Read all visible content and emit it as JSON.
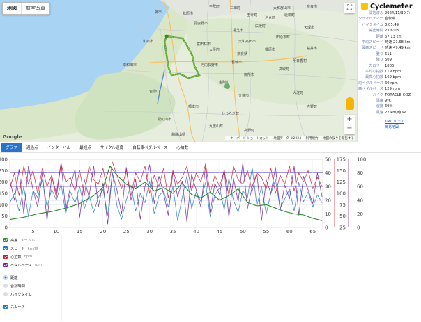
{
  "map": {
    "tabs": [
      {
        "label": "地図",
        "active": true
      },
      {
        "label": "航空写真",
        "active": false
      }
    ],
    "google": "Google",
    "attribution": {
      "shortcuts": "キーボード ショートカット",
      "mapdata": "地図データ ©2024",
      "terms": "利用規約",
      "report": "地図の誤りを報告する"
    },
    "places": [
      "堺市",
      "松原市",
      "羽曳野市",
      "富田林市",
      "河内長野市",
      "和泉市",
      "岸和田市",
      "大阪府",
      "奈良県",
      "金剛山",
      "五條市",
      "御所市",
      "橿原市",
      "大和高田市",
      "香芝市",
      "葛城市",
      "広陵町",
      "王寺町",
      "田原本町",
      "天理市",
      "桜井市",
      "大淀町",
      "吉野町",
      "高取町",
      "明日香村",
      "岩湧山",
      "和歌山県",
      "紀の川市",
      "橋本市",
      "かつらぎ町",
      "九度山町",
      "高野町",
      "大和郡山市",
      "奈良市",
      "河合町",
      "三郷町",
      "平群町",
      "斑鳩町"
    ]
  },
  "info": {
    "app_name": "Cyclemeter",
    "stats": [
      {
        "label": "開始済み",
        "value": "2024/11/30 7:"
      },
      {
        "label": "アクティビティー",
        "value": "自転車"
      },
      {
        "label": "バイクタイム",
        "value": "3:05:49"
      },
      {
        "label": "停止時間",
        "value": "2:06:03"
      },
      {
        "label": "距離",
        "value": "67.13 km"
      },
      {
        "label": "平均スピード",
        "value": "時速 21.68 km"
      },
      {
        "label": "最高スピード",
        "value": "時速 49.49 km"
      },
      {
        "label": "登り",
        "value": "611"
      },
      {
        "label": "降り",
        "value": "609"
      },
      {
        "label": "カロリー",
        "value": "1886"
      },
      {
        "label": "平均心拍数",
        "value": "119 bpm"
      },
      {
        "label": "最高心拍数",
        "value": "169 bpm"
      },
      {
        "label": "平均ペダルペース",
        "value": "60 rpm"
      },
      {
        "label": "最高ペダルペース",
        "value": "129 rpm"
      },
      {
        "label": "バイク",
        "value": "TORACLE-COZ"
      },
      {
        "label": "温度",
        "value": "9ºC"
      },
      {
        "label": "湿度",
        "value": "69%"
      },
      {
        "label": "風速",
        "value": "22 km/時 W"
      }
    ],
    "kml_link": "KML リンク",
    "more_link": "簡易地図"
  },
  "tabs": [
    {
      "label": "グラフ",
      "active": true
    },
    {
      "label": "通過点",
      "active": false
    },
    {
      "label": "インターバル",
      "active": false
    },
    {
      "label": "最短点",
      "active": false
    },
    {
      "label": "サイクル速度",
      "active": false
    },
    {
      "label": "自転車ペダルペース",
      "active": false
    },
    {
      "label": "心拍数",
      "active": false
    }
  ],
  "options": {
    "series": [
      {
        "label": "高度",
        "unit": "メートル",
        "color": "#2b8a2b",
        "checked": true
      },
      {
        "label": "スピード",
        "unit": "km/時",
        "color": "#1f78c8",
        "checked": true
      },
      {
        "label": "心拍数",
        "unit": "bpm",
        "color": "#d0192b",
        "checked": true
      },
      {
        "label": "ペダルペース",
        "unit": "rpm",
        "color": "#6a1b9a",
        "checked": true
      }
    ],
    "xaxis": [
      {
        "label": "距離",
        "selected": true
      },
      {
        "label": "合計時間",
        "selected": false
      },
      {
        "label": "バイクタイム",
        "selected": false
      }
    ],
    "smooth": {
      "label": "スムーズ",
      "checked": true
    }
  },
  "chart_data": {
    "type": "line",
    "x": {
      "label": "距離 (km)",
      "ticks": [
        5,
        10,
        15,
        20,
        25,
        30,
        35,
        40,
        45,
        50,
        55,
        60,
        65
      ],
      "range": [
        0,
        67.13
      ]
    },
    "axes": {
      "altitude": {
        "ticks": [
          0,
          50,
          100,
          150,
          200,
          250,
          300
        ],
        "range": [
          0,
          300
        ]
      },
      "speed": {
        "ticks": [
          0,
          10,
          20,
          30,
          40,
          50
        ],
        "range": [
          0,
          50
        ]
      },
      "heart_rate": {
        "ticks": [
          25,
          50,
          75,
          100,
          125,
          150,
          175
        ],
        "range": [
          25,
          175
        ]
      },
      "cadence": {
        "ticks": [
          0,
          20,
          40,
          60,
          80,
          100
        ],
        "range": [
          0,
          100
        ]
      }
    },
    "series": [
      {
        "name": "高度",
        "axis": "altitude",
        "color": "#2b8a2b",
        "x": [
          0,
          3,
          6,
          9,
          12,
          15,
          18,
          20,
          21.5,
          23,
          25,
          27,
          29,
          31,
          33,
          35,
          37,
          39,
          41,
          43,
          45,
          47,
          49,
          51,
          53,
          55,
          57,
          59,
          61,
          63,
          65,
          67
        ],
        "y": [
          35,
          45,
          60,
          70,
          85,
          105,
          140,
          175,
          270,
          230,
          190,
          170,
          200,
          160,
          175,
          150,
          195,
          145,
          130,
          155,
          120,
          140,
          170,
          110,
          95,
          100,
          85,
          70,
          60,
          55,
          40,
          30
        ]
      },
      {
        "name": "スピード",
        "axis": "speed",
        "color": "#1f78c8",
        "x": [
          0,
          1,
          2,
          3,
          4,
          5,
          6,
          7,
          8,
          9,
          10,
          11,
          12,
          13,
          14,
          15,
          16,
          17,
          18,
          19,
          20,
          21,
          22,
          23,
          24,
          25,
          26,
          27,
          28,
          29,
          30,
          31,
          32,
          33,
          34,
          35,
          36,
          37,
          38,
          39,
          40,
          41,
          42,
          43,
          44,
          45,
          46,
          47,
          48,
          49,
          50,
          51,
          52,
          53,
          54,
          55,
          56,
          57,
          58,
          59,
          60,
          61,
          62,
          63,
          64,
          65,
          66,
          67
        ],
        "y": [
          18,
          25,
          12,
          30,
          8,
          27,
          22,
          35,
          15,
          28,
          20,
          32,
          10,
          26,
          18,
          30,
          14,
          24,
          11,
          22,
          28,
          9,
          40,
          16,
          6,
          20,
          31,
          12,
          25,
          18,
          34,
          10,
          23,
          27,
          15,
          30,
          5,
          22,
          38,
          14,
          26,
          19,
          33,
          8,
          24,
          29,
          13,
          36,
          20,
          11,
          27,
          22,
          44,
          16,
          30,
          10,
          25,
          35,
          14,
          21,
          28,
          12,
          33,
          19,
          26,
          15,
          24,
          18
        ]
      },
      {
        "name": "心拍数",
        "axis": "heart_rate",
        "color": "#d0192b",
        "x": [
          0,
          1,
          2,
          3,
          4,
          5,
          6,
          7,
          8,
          9,
          10,
          11,
          12,
          13,
          14,
          15,
          16,
          17,
          18,
          19,
          20,
          21,
          22,
          23,
          24,
          25,
          26,
          27,
          28,
          29,
          30,
          31,
          32,
          33,
          34,
          35,
          36,
          37,
          38,
          39,
          40,
          41,
          42,
          43,
          44,
          45,
          46,
          47,
          48,
          49,
          50,
          51,
          52,
          53,
          54,
          55,
          56,
          57,
          58,
          59,
          60,
          61,
          62,
          63,
          64,
          65,
          66,
          67
        ],
        "y": [
          110,
          145,
          95,
          160,
          120,
          150,
          100,
          155,
          115,
          140,
          90,
          165,
          125,
          135,
          105,
          150,
          95,
          160,
          130,
          120,
          155,
          100,
          169,
          140,
          110,
          150,
          95,
          145,
          125,
          160,
          100,
          140,
          115,
          155,
          90,
          150,
          120,
          135,
          160,
          105,
          145,
          125,
          165,
          100,
          140,
          115,
          150,
          95,
          160,
          130,
          120,
          150,
          105,
          145,
          135,
          110,
          155,
          100,
          140,
          120,
          160,
          105,
          145,
          125,
          150,
          110,
          135,
          115
        ]
      },
      {
        "name": "ペダルペース",
        "axis": "cadence",
        "color": "#6a1b9a",
        "x": [
          0,
          1,
          2,
          3,
          4,
          5,
          6,
          7,
          8,
          9,
          10,
          11,
          12,
          13,
          14,
          15,
          16,
          17,
          18,
          19,
          20,
          21,
          22,
          23,
          24,
          25,
          26,
          27,
          28,
          29,
          30,
          31,
          32,
          33,
          34,
          35,
          36,
          37,
          38,
          39,
          40,
          41,
          42,
          43,
          44,
          45,
          46,
          47,
          48,
          49,
          50,
          51,
          52,
          53,
          54,
          55,
          56,
          57,
          58,
          59,
          60,
          61,
          62,
          63,
          64,
          65,
          66,
          67
        ],
        "y": [
          70,
          40,
          85,
          20,
          90,
          55,
          30,
          80,
          10,
          75,
          50,
          95,
          25,
          60,
          85,
          15,
          70,
          45,
          90,
          30,
          65,
          5,
          80,
          55,
          20,
          88,
          40,
          70,
          12,
          60,
          92,
          35,
          75,
          50,
          18,
          82,
          45,
          68,
          8,
          78,
          55,
          30,
          90,
          22,
          65,
          48,
          85,
          15,
          72,
          38,
          95,
          28,
          60,
          80,
          10,
          70,
          50,
          88,
          25,
          62,
          42,
          90,
          18,
          75,
          55,
          35,
          80,
          45
        ]
      }
    ],
    "reference_lines": {
      "color": "#7a6fd0"
    }
  }
}
